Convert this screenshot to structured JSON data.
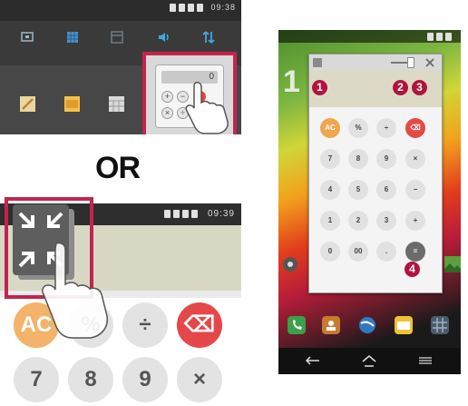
{
  "panel_a": {
    "status_text": "09:38",
    "calculator_display": "0",
    "mini_keys": [
      "+",
      "−",
      "×",
      "÷"
    ]
  },
  "or_label": "OR",
  "panel_b": {
    "status_text": "09:39",
    "keys_row1": [
      "AC",
      "%",
      "÷",
      "⌫"
    ],
    "keys_row2": [
      "7",
      "8",
      "9",
      "×"
    ]
  },
  "phone": {
    "clock": "1",
    "calculator": {
      "rows": [
        [
          "AC",
          "%",
          "÷",
          "⌫"
        ],
        [
          "7",
          "8",
          "9",
          "×"
        ],
        [
          "4",
          "5",
          "6",
          "−"
        ],
        [
          "1",
          "2",
          "3",
          "+"
        ],
        [
          "0",
          "00",
          ".",
          "="
        ]
      ]
    },
    "callouts": [
      "1",
      "2",
      "3",
      "4"
    ]
  },
  "colors": {
    "highlight_border": "#c3244f",
    "callout": "#b3123f"
  },
  "icons": {
    "panel_a_quick_settings": [
      "screen-icon",
      "grid-icon",
      "window-icon",
      "volume-icon",
      "data-icon"
    ],
    "panel_a_apps": [
      "memo-icon",
      "notebook-icon",
      "calendar-icon"
    ],
    "panel_b": [
      "minimize-icon"
    ],
    "phone_dock": [
      "phone-icon",
      "contacts-icon",
      "internet-icon",
      "email-icon",
      "apps-icon"
    ],
    "phone_nav": [
      "back-icon",
      "home-icon",
      "menu-icon"
    ]
  }
}
